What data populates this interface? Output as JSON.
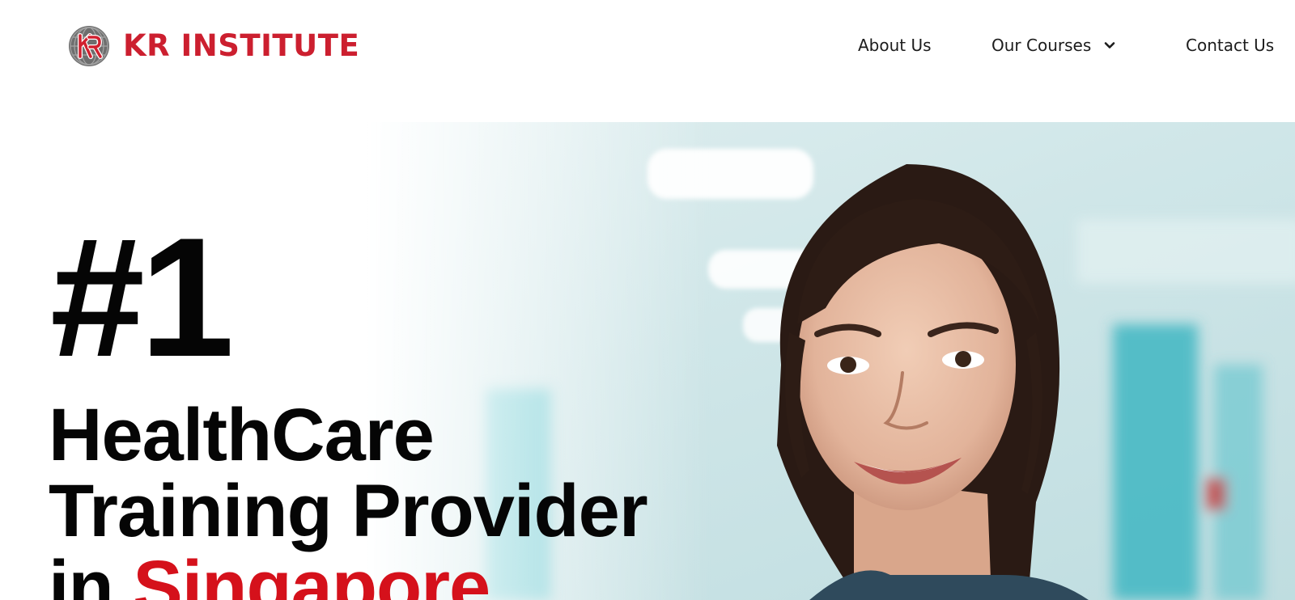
{
  "brand": {
    "name": "KR INSTITUTE",
    "logo_icon": "globe-kr-icon",
    "color": "#cc1f2f"
  },
  "nav": {
    "items": [
      {
        "label": "About Us"
      },
      {
        "label": "Our Courses",
        "icon": "chevron-down-icon"
      },
      {
        "label": "Contact Us"
      }
    ]
  },
  "hero": {
    "rank": "#1",
    "line1": "HealthCare",
    "line2": "Training Provider",
    "line3_prefix": "in ",
    "line3_accent": "Singapore",
    "accent_color": "#d5111b",
    "image_subject": "smiling-healthcare-worker-photo"
  }
}
